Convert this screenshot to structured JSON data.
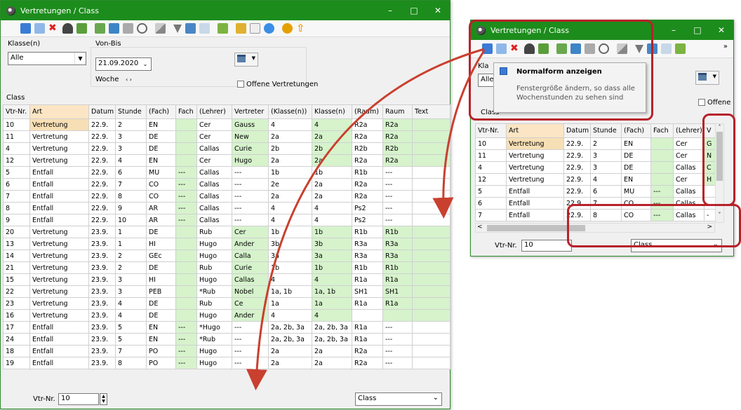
{
  "main_window": {
    "title": "Vertretungen / Class",
    "filters": {
      "klasse_label": "Klasse(n)",
      "klasse_value": "Alle",
      "vonbis_label": "Von-Bis",
      "date_value": "21.09.2020",
      "period_value": "Woche",
      "offene_label": "Offene Vertretungen",
      "class_label": "Class"
    },
    "columns": [
      "Vtr-Nr.",
      "Art",
      "Datum",
      "Stunde",
      "(Fach)",
      "Fach",
      "(Lehrer)",
      "Vertreter",
      "(Klasse(n))",
      "Klasse(n)",
      "(Raum)",
      "Raum",
      "Text"
    ],
    "rows": [
      [
        "10",
        "Vertretung",
        "22.9.",
        "2",
        "EN",
        "",
        "Cer",
        "Gauss",
        "4",
        "4",
        "R2a",
        "R2a",
        ""
      ],
      [
        "11",
        "Vertretung",
        "22.9.",
        "3",
        "DE",
        "",
        "Cer",
        "New",
        "2a",
        "2a",
        "R2a",
        "R2a",
        ""
      ],
      [
        "4",
        "Vertretung",
        "22.9.",
        "3",
        "DE",
        "",
        "Callas",
        "Curie",
        "2b",
        "2b",
        "R2b",
        "R2b",
        ""
      ],
      [
        "12",
        "Vertretung",
        "22.9.",
        "4",
        "EN",
        "",
        "Cer",
        "Hugo",
        "2a",
        "2a",
        "R2a",
        "R2a",
        ""
      ],
      [
        "5",
        "Entfall",
        "22.9.",
        "6",
        "MU",
        "---",
        "Callas",
        "---",
        "1b",
        "1b",
        "R1b",
        "---",
        ""
      ],
      [
        "6",
        "Entfall",
        "22.9.",
        "7",
        "CO",
        "---",
        "Callas",
        "---",
        "2e",
        "2a",
        "R2a",
        "---",
        ""
      ],
      [
        "7",
        "Entfall",
        "22.9.",
        "8",
        "CO",
        "---",
        "Callas",
        "---",
        "2a",
        "2a",
        "R2a",
        "---",
        ""
      ],
      [
        "8",
        "Entfall",
        "22.9.",
        "9",
        "AR",
        "---",
        "Callas",
        "---",
        "4",
        "4",
        "Ps2",
        "---",
        ""
      ],
      [
        "9",
        "Entfall",
        "22.9.",
        "10",
        "AR",
        "---",
        "Callas",
        "---",
        "4",
        "4",
        "Ps2",
        "---",
        ""
      ],
      [
        "20",
        "Vertretung",
        "23.9.",
        "1",
        "DE",
        "",
        "Rub",
        "Cer",
        "1b",
        "1b",
        "R1b",
        "R1b",
        ""
      ],
      [
        "13",
        "Vertretung",
        "23.9.",
        "1",
        "HI",
        "",
        "Hugo",
        "Ander",
        "3b",
        "3b",
        "R3a",
        "R3a",
        ""
      ],
      [
        "14",
        "Vertretung",
        "23.9.",
        "2",
        "GEc",
        "",
        "Hugo",
        "Calla",
        "3a",
        "3a",
        "R3a",
        "R3a",
        ""
      ],
      [
        "21",
        "Vertretung",
        "23.9.",
        "2",
        "DE",
        "",
        "Rub",
        "Curie",
        "1b",
        "1b",
        "R1b",
        "R1b",
        ""
      ],
      [
        "15",
        "Vertretung",
        "23.9.",
        "3",
        "HI",
        "",
        "Hugo",
        "Callas",
        "4",
        "4",
        "R1a",
        "R1a",
        ""
      ],
      [
        "22",
        "Vertretung",
        "23.9.",
        "3",
        "PEB",
        "",
        "*Rub",
        "Nobel",
        "1a, 1b",
        "1a, 1b",
        "SH1",
        "SH1",
        ""
      ],
      [
        "23",
        "Vertretung",
        "23.9.",
        "4",
        "DE",
        "",
        "Rub",
        "Ce",
        "1a",
        "1a",
        "R1a",
        "R1a",
        ""
      ],
      [
        "16",
        "Vertretung",
        "23.9.",
        "4",
        "DE",
        "",
        "Hugo",
        "Ander",
        "4",
        "4",
        "",
        "",
        ""
      ],
      [
        "17",
        "Entfall",
        "23.9.",
        "5",
        "EN",
        "---",
        "*Hugo",
        "---",
        "2a, 2b, 3a",
        "2a, 2b, 3a",
        "R1a",
        "---",
        ""
      ],
      [
        "24",
        "Entfall",
        "23.9.",
        "5",
        "EN",
        "---",
        "*Rub",
        "---",
        "2a, 2b, 3a",
        "2a, 2b, 3a",
        "R1a",
        "---",
        ""
      ],
      [
        "18",
        "Entfall",
        "23.9.",
        "7",
        "PO",
        "---",
        "Hugo",
        "---",
        "2a",
        "2a",
        "R2a",
        "---",
        ""
      ],
      [
        "19",
        "Entfall",
        "23.9.",
        "8",
        "PO",
        "---",
        "Hugo",
        "---",
        "2a",
        "2a",
        "R2a",
        "---",
        ""
      ]
    ],
    "status": {
      "vtr_label": "Vtr-Nr.",
      "vtr_value": "10",
      "format_value": "Class"
    }
  },
  "small_window": {
    "title": "Vertretungen / Class",
    "tooltip_title": "Normalform anzeigen",
    "tooltip_text": "Fenstergröße ändern, so dass alle Wochenstunden zu sehen sind",
    "klasse_partial": "Kla",
    "klasse_value_partial": "Alle",
    "offene_partial": "Offene",
    "class_label": "Class",
    "columns": [
      "Vtr-Nr.",
      "Art",
      "Datum",
      "Stunde",
      "(Fach)",
      "Fach",
      "(Lehrer)",
      "V"
    ],
    "rows": [
      [
        "10",
        "Vertretung",
        "22.9.",
        "2",
        "EN",
        "",
        "Cer",
        "G"
      ],
      [
        "11",
        "Vertretung",
        "22.9.",
        "3",
        "DE",
        "",
        "Cer",
        "N"
      ],
      [
        "4",
        "Vertretung",
        "22.9.",
        "3",
        "DE",
        "",
        "Callas",
        "C"
      ],
      [
        "12",
        "Vertretung",
        "22.9.",
        "4",
        "EN",
        "",
        "Cer",
        "H"
      ],
      [
        "5",
        "Entfall",
        "22.9.",
        "6",
        "MU",
        "---",
        "Callas",
        ""
      ],
      [
        "6",
        "Entfall",
        "22.9.",
        "7",
        "CO",
        "---",
        "Callas",
        ""
      ],
      [
        "7",
        "Entfall",
        "22.9.",
        "8",
        "CO",
        "---",
        "Callas",
        "-"
      ]
    ],
    "status": {
      "vtr_label": "Vtr-Nr.",
      "vtr_value": "10",
      "format_value": "Class"
    }
  },
  "colors": {
    "titlebar": "#1c8c1c",
    "highlight": "#b8222a",
    "green_cell": "#d6f3cc",
    "selected_cell": "#f7dfb5"
  }
}
